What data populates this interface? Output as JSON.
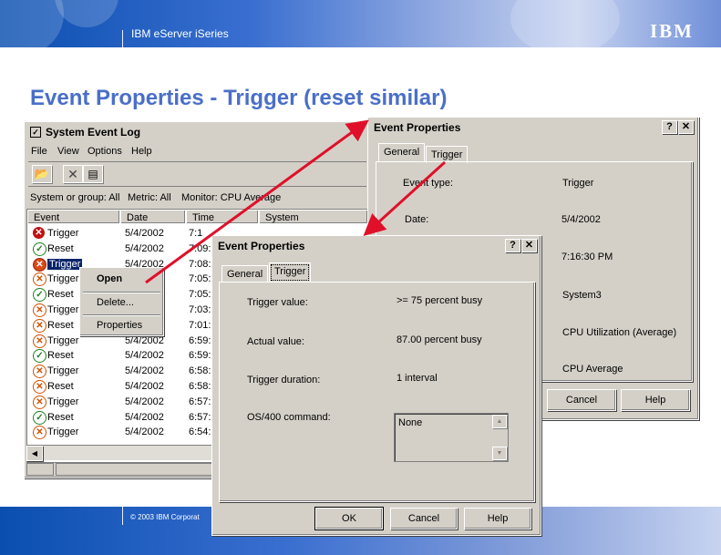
{
  "banner": {
    "title": "IBM eServer iSeries",
    "logo": "IBM"
  },
  "slide_title": "Event Properties - Trigger (reset similar)",
  "footer": {
    "copyright": "© 2003 IBM Corporat"
  },
  "sel": {
    "title": "System Event Log",
    "menu": [
      "File",
      "View",
      "Options",
      "Help"
    ],
    "info": {
      "system": "System or group: All",
      "metric": "Metric: All",
      "monitor": "Monitor: CPU Average"
    },
    "columns": [
      "Event",
      "Date",
      "Time",
      "System"
    ],
    "rows": [
      {
        "event": "Trigger",
        "date": "5/4/2002",
        "time": "7:1",
        "icon": "err"
      },
      {
        "event": "Reset",
        "date": "5/4/2002",
        "time": "7:09:",
        "icon": "reset"
      },
      {
        "event": "Trigger",
        "date": "5/4/2002",
        "time": "7:08:",
        "icon": "trig"
      },
      {
        "event": "Trigger",
        "date": "",
        "time": "7:05:",
        "icon": "trig2"
      },
      {
        "event": "Reset",
        "date": "",
        "time": "7:05:",
        "icon": "reset"
      },
      {
        "event": "Trigger",
        "date": "",
        "time": "7:03:",
        "icon": "trig2"
      },
      {
        "event": "Reset",
        "date": "",
        "time": "7:01:",
        "icon": "trig2"
      },
      {
        "event": "Trigger",
        "date": "5/4/2002",
        "time": "6:59:",
        "icon": "trig2"
      },
      {
        "event": "Reset",
        "date": "5/4/2002",
        "time": "6:59:",
        "icon": "reset"
      },
      {
        "event": "Trigger",
        "date": "5/4/2002",
        "time": "6:58:",
        "icon": "trig2"
      },
      {
        "event": "Reset",
        "date": "5/4/2002",
        "time": "6:58:",
        "icon": "trig2"
      },
      {
        "event": "Trigger",
        "date": "5/4/2002",
        "time": "6:57:",
        "icon": "trig2"
      },
      {
        "event": "Reset",
        "date": "5/4/2002",
        "time": "6:57:",
        "icon": "reset"
      },
      {
        "event": "Trigger",
        "date": "5/4/2002",
        "time": "6:54:",
        "icon": "trig2"
      }
    ]
  },
  "context_menu": {
    "open": "Open",
    "delete": "Delete...",
    "properties": "Properties"
  },
  "ep_back": {
    "title": "Event Properties",
    "tabs": [
      "General",
      "Trigger"
    ],
    "fields": [
      {
        "label": "Event type:",
        "value": "Trigger"
      },
      {
        "label": "Date:",
        "value": "5/4/2002"
      },
      {
        "label": "",
        "value": "7:16:30 PM"
      },
      {
        "label": "",
        "value": "System3"
      },
      {
        "label": "",
        "value": "CPU Utilization (Average)"
      },
      {
        "label": "",
        "value": "CPU Average"
      }
    ],
    "cancel": "Cancel",
    "help": "Help"
  },
  "ep_front": {
    "title": "Event Properties",
    "tabs": [
      "General",
      "Trigger"
    ],
    "fields": [
      {
        "label": "Trigger  value:",
        "value": ">= 75 percent busy"
      },
      {
        "label": "Actual value:",
        "value": "87.00 percent busy"
      },
      {
        "label": "Trigger duration:",
        "value": "1 interval"
      },
      {
        "label": "OS/400 command:",
        "value": ""
      }
    ],
    "command_value": "None",
    "ok": "OK",
    "cancel": "Cancel",
    "help": "Help"
  },
  "colors": {
    "title_blue": "#4a6fc8",
    "arrow_red": "#e0102a",
    "window_gray": "#d4d0c8"
  }
}
